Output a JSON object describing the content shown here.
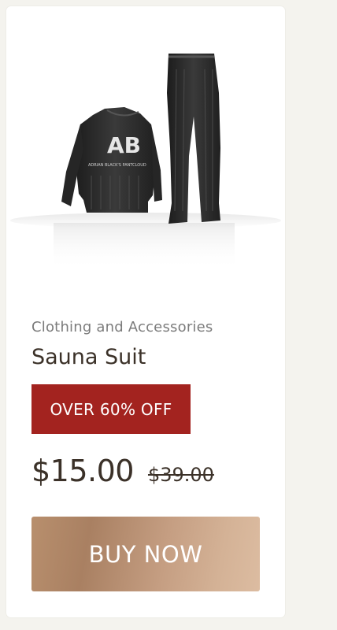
{
  "product": {
    "image_icon": "sauna-suit-image",
    "image_logo_text": "ADRIAN BLACK'S PANTCLOUD",
    "category": "Clothing and Accessories",
    "name": "Sauna Suit",
    "badge": "OVER 60% OFF",
    "price": "$15.00",
    "old_price": "$39.00",
    "buy_label": "BUY NOW"
  },
  "colors": {
    "page_background": "#f4f3ee",
    "card_background": "#ffffff",
    "badge_red": "#a3231f",
    "text_dark": "#3b3128",
    "text_muted": "#7b7b7b",
    "button_gradient_start": "#b88f6d",
    "button_gradient_end": "#dcbca1"
  }
}
